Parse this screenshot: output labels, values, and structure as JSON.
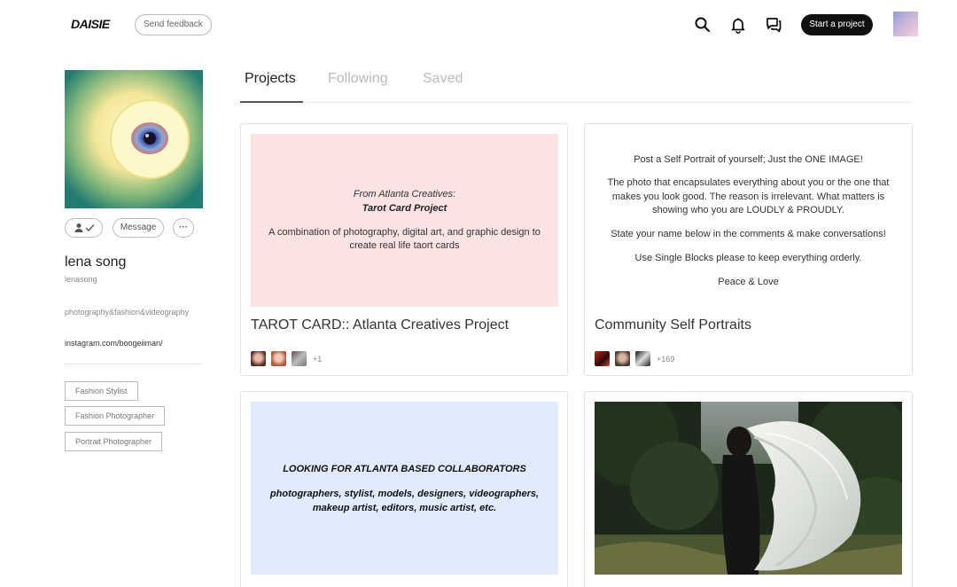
{
  "header": {
    "logo": "DAISIE",
    "feedback_label": "Send feedback",
    "start_label": "Start a project"
  },
  "profile": {
    "message_label": "Message",
    "more_label": "···",
    "name": "lena song",
    "handle": "lenasong",
    "bio": "photography&fashion&videography",
    "instagram": "instagram.com/boogeiiman/",
    "tags": [
      "Fashion Stylist",
      "Fashion Photographer",
      "Portrait Photographer"
    ]
  },
  "tabs": [
    "Projects",
    "Following",
    "Saved"
  ],
  "cards": [
    {
      "cover_line1": "From Atlanta Creatives:",
      "cover_line2": "Tarot Card Project",
      "cover_line3": "A combination of photography, digital art, and graphic design to create real life taort cards",
      "title": "TAROT CARD:: Atlanta Creatives Project",
      "more": "+1"
    },
    {
      "cover_p1": "Post a Self Portrait of yourself; Just the ONE IMAGE!",
      "cover_p2": "The photo that encapsulates everything about you or the one that makes you look good. The reason is irrelevant. What matters is showing who you are LOUDLY & PROUDLY.",
      "cover_p3": "State your name below in the comments & make conversations!",
      "cover_p4": "Use Single Blocks please to keep everything orderly.",
      "cover_p5": "Peace & Love",
      "title": "Community Self Portraits",
      "more": "+169"
    },
    {
      "cover_heading": "LOOKING FOR ATLANTA BASED COLLABORATORS",
      "cover_sub": "photographers, stylist, models, designers, videographers, makeup artist, editors, music artist, etc."
    },
    {}
  ]
}
